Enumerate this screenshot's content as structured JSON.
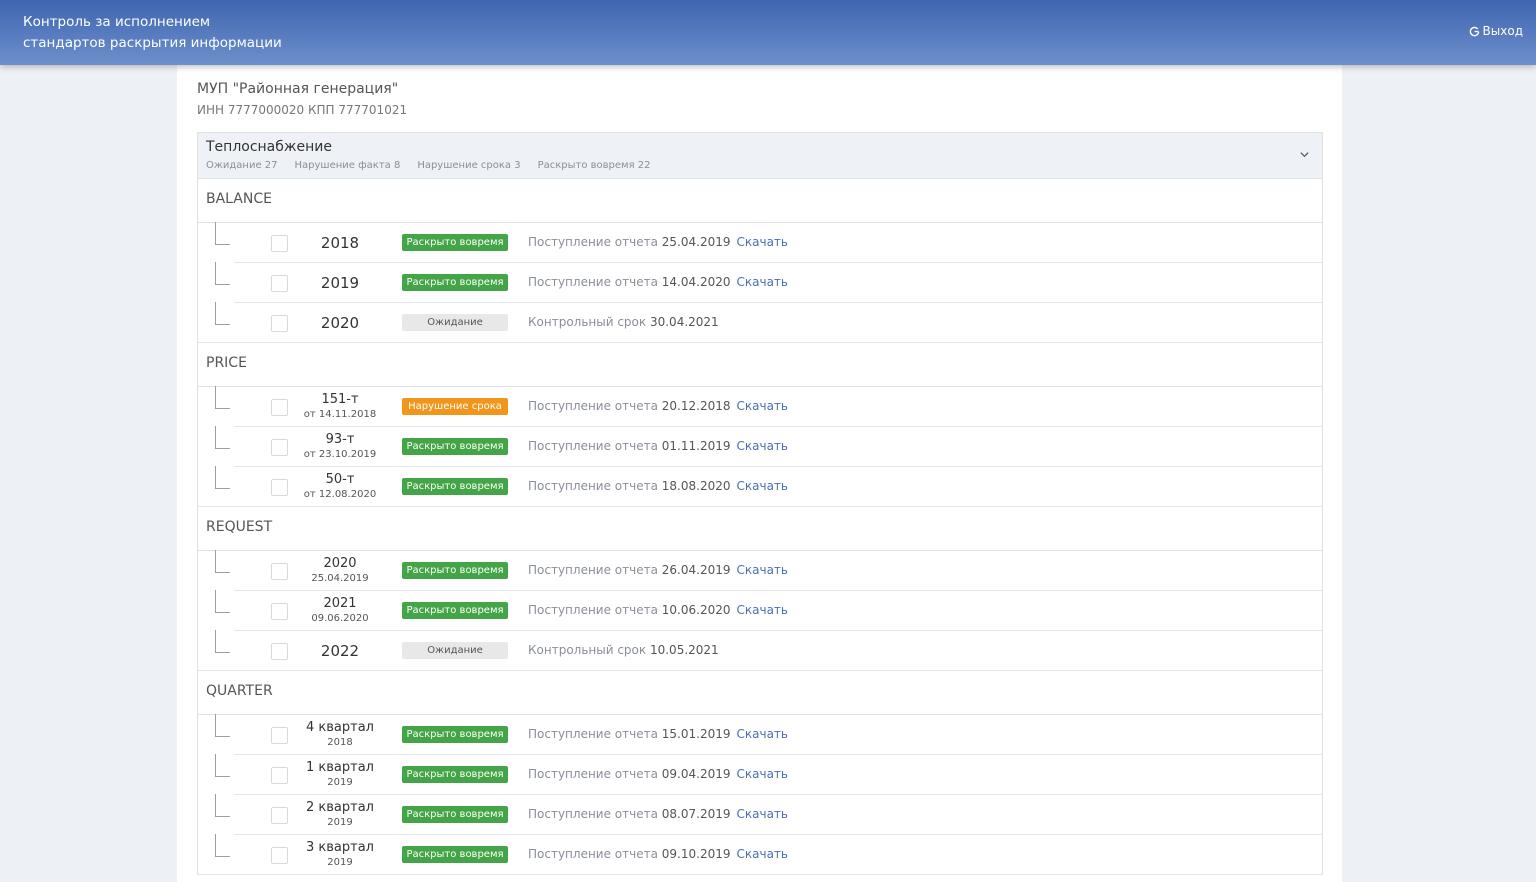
{
  "header": {
    "title_line1": "Контроль за исполнением",
    "title_line2": "стандартов раскрытия информации",
    "logout_label": "Выход",
    "logout_icon": "logout-icon"
  },
  "org": {
    "name": "МУП \"Районная генерация\"",
    "ids": "ИНН 7777000020 КПП 777701021"
  },
  "panel": {
    "title": "Теплоснабжение",
    "stats": [
      "Ожидание 27",
      "Нарушение факта 8",
      "Нарушение срока 3",
      "Раскрыто вовремя 22"
    ]
  },
  "colors": {
    "ok": "#43a547",
    "late": "#f0961c",
    "wait": "#e8e8e8",
    "link": "#4a6fb5",
    "header": "#3f65b0"
  },
  "sections": [
    {
      "title": "BALANCE",
      "rows": [
        {
          "main": "2018",
          "sub": "",
          "badge": "Раскрыто вовремя",
          "status": "ok",
          "info_label": "Поступление отчета",
          "info_date": "25.04.2019",
          "link": "Скачать"
        },
        {
          "main": "2019",
          "sub": "",
          "badge": "Раскрыто вовремя",
          "status": "ok",
          "info_label": "Поступление отчета",
          "info_date": "14.04.2020",
          "link": "Скачать"
        },
        {
          "main": "2020",
          "sub": "",
          "badge": "Ожидание",
          "status": "wait",
          "info_label": "Контрольный срок",
          "info_date": "30.04.2021",
          "link": ""
        }
      ]
    },
    {
      "title": "PRICE",
      "rows": [
        {
          "main": "151-т",
          "sub": "от 14.11.2018",
          "badge": "Нарушение срока",
          "status": "late",
          "info_label": "Поступление отчета",
          "info_date": "20.12.2018",
          "link": "Скачать"
        },
        {
          "main": "93-т",
          "sub": "от 23.10.2019",
          "badge": "Раскрыто вовремя",
          "status": "ok",
          "info_label": "Поступление отчета",
          "info_date": "01.11.2019",
          "link": "Скачать"
        },
        {
          "main": "50-т",
          "sub": "от 12.08.2020",
          "badge": "Раскрыто вовремя",
          "status": "ok",
          "info_label": "Поступление отчета",
          "info_date": "18.08.2020",
          "link": "Скачать"
        }
      ]
    },
    {
      "title": "REQUEST",
      "rows": [
        {
          "main": "2020",
          "sub": "25.04.2019",
          "badge": "Раскрыто вовремя",
          "status": "ok",
          "info_label": "Поступление отчета",
          "info_date": "26.04.2019",
          "link": "Скачать"
        },
        {
          "main": "2021",
          "sub": "09.06.2020",
          "badge": "Раскрыто вовремя",
          "status": "ok",
          "info_label": "Поступление отчета",
          "info_date": "10.06.2020",
          "link": "Скачать"
        },
        {
          "main": "2022",
          "sub": "",
          "badge": "Ожидание",
          "status": "wait",
          "info_label": "Контрольный срок",
          "info_date": "10.05.2021",
          "link": ""
        }
      ]
    },
    {
      "title": "QUARTER",
      "rows": [
        {
          "main": "4 квартал",
          "sub": "2018",
          "badge": "Раскрыто вовремя",
          "status": "ok",
          "info_label": "Поступление отчета",
          "info_date": "15.01.2019",
          "link": "Скачать"
        },
        {
          "main": "1 квартал",
          "sub": "2019",
          "badge": "Раскрыто вовремя",
          "status": "ok",
          "info_label": "Поступление отчета",
          "info_date": "09.04.2019",
          "link": "Скачать"
        },
        {
          "main": "2 квартал",
          "sub": "2019",
          "badge": "Раскрыто вовремя",
          "status": "ok",
          "info_label": "Поступление отчета",
          "info_date": "08.07.2019",
          "link": "Скачать"
        },
        {
          "main": "3 квартал",
          "sub": "2019",
          "badge": "Раскрыто вовремя",
          "status": "ok",
          "info_label": "Поступление отчета",
          "info_date": "09.10.2019",
          "link": "Скачать"
        }
      ]
    }
  ]
}
